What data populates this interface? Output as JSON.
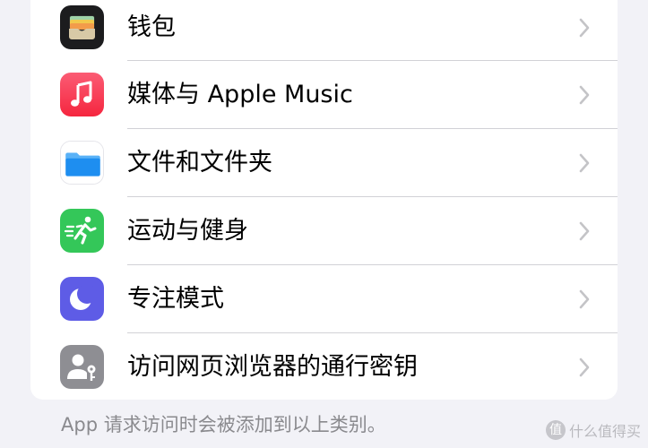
{
  "settings": {
    "items": [
      {
        "label": "钱包",
        "icon": "wallet-icon",
        "color": "#1c1c1e"
      },
      {
        "label": "媒体与 Apple Music",
        "icon": "music-note-icon",
        "color": "#fa3c52"
      },
      {
        "label": "文件和文件夹",
        "icon": "files-folder-icon",
        "color": "#1e8ef0"
      },
      {
        "label": "运动与健身",
        "icon": "fitness-runner-icon",
        "color": "#34c759"
      },
      {
        "label": "专注模式",
        "icon": "moon-icon",
        "color": "#5e5ce6"
      },
      {
        "label": "访问网页浏览器的通行密钥",
        "icon": "passkey-icon",
        "color": "#8e8e93"
      }
    ],
    "footer": "App 请求访问时会被添加到以上类别。"
  },
  "watermark": {
    "text": "什么值得买",
    "badge": "值"
  }
}
